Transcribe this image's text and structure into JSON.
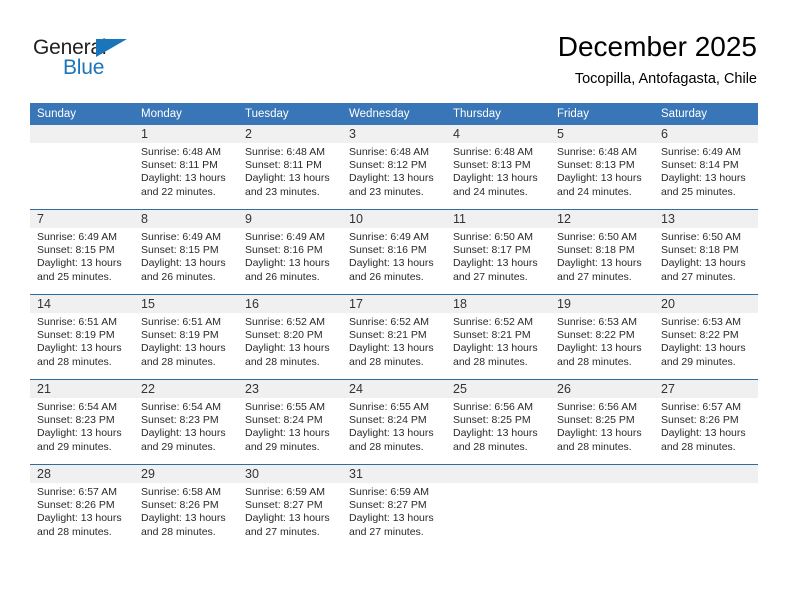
{
  "brand": {
    "name_part1": "General",
    "name_part2": "Blue",
    "triangle_icon": "triangle-logo-icon",
    "accent_color": "#1b75bb"
  },
  "header": {
    "title": "December 2025",
    "subtitle": "Tocopilla, Antofagasta, Chile"
  },
  "calendar": {
    "header_bg": "#3876b8",
    "daynum_band_bg": "#f0f0f0",
    "row_separator_color": "#2e6da4",
    "weekday_headers": [
      "Sunday",
      "Monday",
      "Tuesday",
      "Wednesday",
      "Thursday",
      "Friday",
      "Saturday"
    ],
    "weeks": [
      [
        {
          "day": "",
          "sunrise": "",
          "sunset": "",
          "daylight_line1": "",
          "daylight_line2": ""
        },
        {
          "day": "1",
          "sunrise": "Sunrise: 6:48 AM",
          "sunset": "Sunset: 8:11 PM",
          "daylight_line1": "Daylight: 13 hours",
          "daylight_line2": "and 22 minutes."
        },
        {
          "day": "2",
          "sunrise": "Sunrise: 6:48 AM",
          "sunset": "Sunset: 8:11 PM",
          "daylight_line1": "Daylight: 13 hours",
          "daylight_line2": "and 23 minutes."
        },
        {
          "day": "3",
          "sunrise": "Sunrise: 6:48 AM",
          "sunset": "Sunset: 8:12 PM",
          "daylight_line1": "Daylight: 13 hours",
          "daylight_line2": "and 23 minutes."
        },
        {
          "day": "4",
          "sunrise": "Sunrise: 6:48 AM",
          "sunset": "Sunset: 8:13 PM",
          "daylight_line1": "Daylight: 13 hours",
          "daylight_line2": "and 24 minutes."
        },
        {
          "day": "5",
          "sunrise": "Sunrise: 6:48 AM",
          "sunset": "Sunset: 8:13 PM",
          "daylight_line1": "Daylight: 13 hours",
          "daylight_line2": "and 24 minutes."
        },
        {
          "day": "6",
          "sunrise": "Sunrise: 6:49 AM",
          "sunset": "Sunset: 8:14 PM",
          "daylight_line1": "Daylight: 13 hours",
          "daylight_line2": "and 25 minutes."
        }
      ],
      [
        {
          "day": "7",
          "sunrise": "Sunrise: 6:49 AM",
          "sunset": "Sunset: 8:15 PM",
          "daylight_line1": "Daylight: 13 hours",
          "daylight_line2": "and 25 minutes."
        },
        {
          "day": "8",
          "sunrise": "Sunrise: 6:49 AM",
          "sunset": "Sunset: 8:15 PM",
          "daylight_line1": "Daylight: 13 hours",
          "daylight_line2": "and 26 minutes."
        },
        {
          "day": "9",
          "sunrise": "Sunrise: 6:49 AM",
          "sunset": "Sunset: 8:16 PM",
          "daylight_line1": "Daylight: 13 hours",
          "daylight_line2": "and 26 minutes."
        },
        {
          "day": "10",
          "sunrise": "Sunrise: 6:49 AM",
          "sunset": "Sunset: 8:16 PM",
          "daylight_line1": "Daylight: 13 hours",
          "daylight_line2": "and 26 minutes."
        },
        {
          "day": "11",
          "sunrise": "Sunrise: 6:50 AM",
          "sunset": "Sunset: 8:17 PM",
          "daylight_line1": "Daylight: 13 hours",
          "daylight_line2": "and 27 minutes."
        },
        {
          "day": "12",
          "sunrise": "Sunrise: 6:50 AM",
          "sunset": "Sunset: 8:18 PM",
          "daylight_line1": "Daylight: 13 hours",
          "daylight_line2": "and 27 minutes."
        },
        {
          "day": "13",
          "sunrise": "Sunrise: 6:50 AM",
          "sunset": "Sunset: 8:18 PM",
          "daylight_line1": "Daylight: 13 hours",
          "daylight_line2": "and 27 minutes."
        }
      ],
      [
        {
          "day": "14",
          "sunrise": "Sunrise: 6:51 AM",
          "sunset": "Sunset: 8:19 PM",
          "daylight_line1": "Daylight: 13 hours",
          "daylight_line2": "and 28 minutes."
        },
        {
          "day": "15",
          "sunrise": "Sunrise: 6:51 AM",
          "sunset": "Sunset: 8:19 PM",
          "daylight_line1": "Daylight: 13 hours",
          "daylight_line2": "and 28 minutes."
        },
        {
          "day": "16",
          "sunrise": "Sunrise: 6:52 AM",
          "sunset": "Sunset: 8:20 PM",
          "daylight_line1": "Daylight: 13 hours",
          "daylight_line2": "and 28 minutes."
        },
        {
          "day": "17",
          "sunrise": "Sunrise: 6:52 AM",
          "sunset": "Sunset: 8:21 PM",
          "daylight_line1": "Daylight: 13 hours",
          "daylight_line2": "and 28 minutes."
        },
        {
          "day": "18",
          "sunrise": "Sunrise: 6:52 AM",
          "sunset": "Sunset: 8:21 PM",
          "daylight_line1": "Daylight: 13 hours",
          "daylight_line2": "and 28 minutes."
        },
        {
          "day": "19",
          "sunrise": "Sunrise: 6:53 AM",
          "sunset": "Sunset: 8:22 PM",
          "daylight_line1": "Daylight: 13 hours",
          "daylight_line2": "and 28 minutes."
        },
        {
          "day": "20",
          "sunrise": "Sunrise: 6:53 AM",
          "sunset": "Sunset: 8:22 PM",
          "daylight_line1": "Daylight: 13 hours",
          "daylight_line2": "and 29 minutes."
        }
      ],
      [
        {
          "day": "21",
          "sunrise": "Sunrise: 6:54 AM",
          "sunset": "Sunset: 8:23 PM",
          "daylight_line1": "Daylight: 13 hours",
          "daylight_line2": "and 29 minutes."
        },
        {
          "day": "22",
          "sunrise": "Sunrise: 6:54 AM",
          "sunset": "Sunset: 8:23 PM",
          "daylight_line1": "Daylight: 13 hours",
          "daylight_line2": "and 29 minutes."
        },
        {
          "day": "23",
          "sunrise": "Sunrise: 6:55 AM",
          "sunset": "Sunset: 8:24 PM",
          "daylight_line1": "Daylight: 13 hours",
          "daylight_line2": "and 29 minutes."
        },
        {
          "day": "24",
          "sunrise": "Sunrise: 6:55 AM",
          "sunset": "Sunset: 8:24 PM",
          "daylight_line1": "Daylight: 13 hours",
          "daylight_line2": "and 28 minutes."
        },
        {
          "day": "25",
          "sunrise": "Sunrise: 6:56 AM",
          "sunset": "Sunset: 8:25 PM",
          "daylight_line1": "Daylight: 13 hours",
          "daylight_line2": "and 28 minutes."
        },
        {
          "day": "26",
          "sunrise": "Sunrise: 6:56 AM",
          "sunset": "Sunset: 8:25 PM",
          "daylight_line1": "Daylight: 13 hours",
          "daylight_line2": "and 28 minutes."
        },
        {
          "day": "27",
          "sunrise": "Sunrise: 6:57 AM",
          "sunset": "Sunset: 8:26 PM",
          "daylight_line1": "Daylight: 13 hours",
          "daylight_line2": "and 28 minutes."
        }
      ],
      [
        {
          "day": "28",
          "sunrise": "Sunrise: 6:57 AM",
          "sunset": "Sunset: 8:26 PM",
          "daylight_line1": "Daylight: 13 hours",
          "daylight_line2": "and 28 minutes."
        },
        {
          "day": "29",
          "sunrise": "Sunrise: 6:58 AM",
          "sunset": "Sunset: 8:26 PM",
          "daylight_line1": "Daylight: 13 hours",
          "daylight_line2": "and 28 minutes."
        },
        {
          "day": "30",
          "sunrise": "Sunrise: 6:59 AM",
          "sunset": "Sunset: 8:27 PM",
          "daylight_line1": "Daylight: 13 hours",
          "daylight_line2": "and 27 minutes."
        },
        {
          "day": "31",
          "sunrise": "Sunrise: 6:59 AM",
          "sunset": "Sunset: 8:27 PM",
          "daylight_line1": "Daylight: 13 hours",
          "daylight_line2": "and 27 minutes."
        },
        {
          "day": "",
          "sunrise": "",
          "sunset": "",
          "daylight_line1": "",
          "daylight_line2": ""
        },
        {
          "day": "",
          "sunrise": "",
          "sunset": "",
          "daylight_line1": "",
          "daylight_line2": ""
        },
        {
          "day": "",
          "sunrise": "",
          "sunset": "",
          "daylight_line1": "",
          "daylight_line2": ""
        }
      ]
    ]
  }
}
